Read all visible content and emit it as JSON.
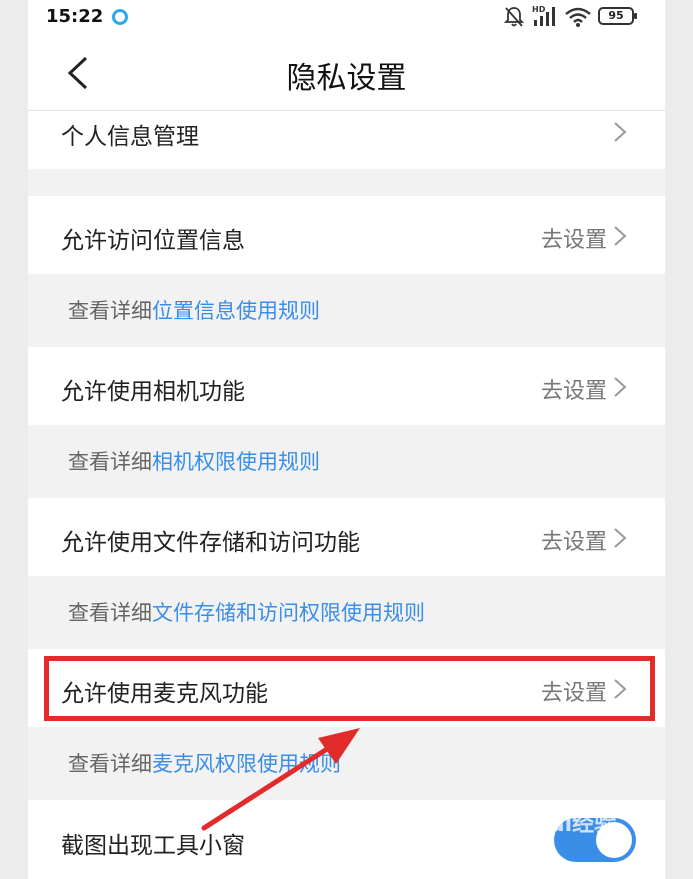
{
  "status_bar": {
    "time": "15:22",
    "battery": "95",
    "network": "HD"
  },
  "header": {
    "title": "隐私设置"
  },
  "rows": {
    "personal_info": {
      "label": "个人信息管理"
    },
    "location": {
      "label": "允许访问位置信息",
      "action": "去设置"
    },
    "camera": {
      "label": "允许使用相机功能",
      "action": "去设置"
    },
    "storage": {
      "label": "允许使用文件存储和访问功能",
      "action": "去设置"
    },
    "microphone": {
      "label": "允许使用麦克风功能",
      "action": "去设置"
    },
    "screenshot": {
      "label": "截图出现工具小窗"
    }
  },
  "hints": {
    "prefix": "查看详细",
    "location_link": "位置信息使用规则",
    "camera_link": "相机权限使用规则",
    "storage_link": "文件存储和访问权限使用规则",
    "microphone_link": "麦克风权限使用规则"
  },
  "watermark": "Bai经验",
  "colors": {
    "link": "#3a8ee8",
    "highlight": "#e22b2b",
    "toggle_on": "#3a8ee8"
  },
  "toggles": {
    "screenshot_enabled": true
  }
}
